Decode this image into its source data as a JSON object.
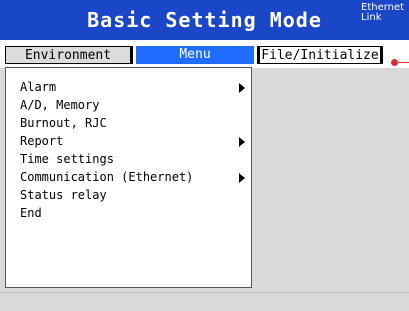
{
  "header": {
    "title": "Basic Setting Mode",
    "status_line1": "Ethernet",
    "status_line2": "Link"
  },
  "tabs": [
    {
      "label": "Environment"
    },
    {
      "label": "Menu",
      "selected": true
    },
    {
      "label": "File/Initialize"
    }
  ],
  "menu": {
    "items": [
      {
        "label": "Alarm",
        "has_submenu": true
      },
      {
        "label": "A/D, Memory",
        "has_submenu": false
      },
      {
        "label": "Burnout, RJC",
        "has_submenu": false
      },
      {
        "label": "Report",
        "has_submenu": true
      },
      {
        "label": "Time settings",
        "has_submenu": false
      },
      {
        "label": "Communication (Ethernet)",
        "has_submenu": true
      },
      {
        "label": "Status relay",
        "has_submenu": false
      },
      {
        "label": "End",
        "has_submenu": false
      }
    ]
  },
  "colors": {
    "title_bar": "#1a46c8",
    "selected_tab": "#1e6bff",
    "indicator": "#e0282c",
    "background": "#d9d9d9"
  },
  "icons": {
    "submenu": "right-triangle-arrow",
    "scroll": "red-dot-indicator"
  }
}
